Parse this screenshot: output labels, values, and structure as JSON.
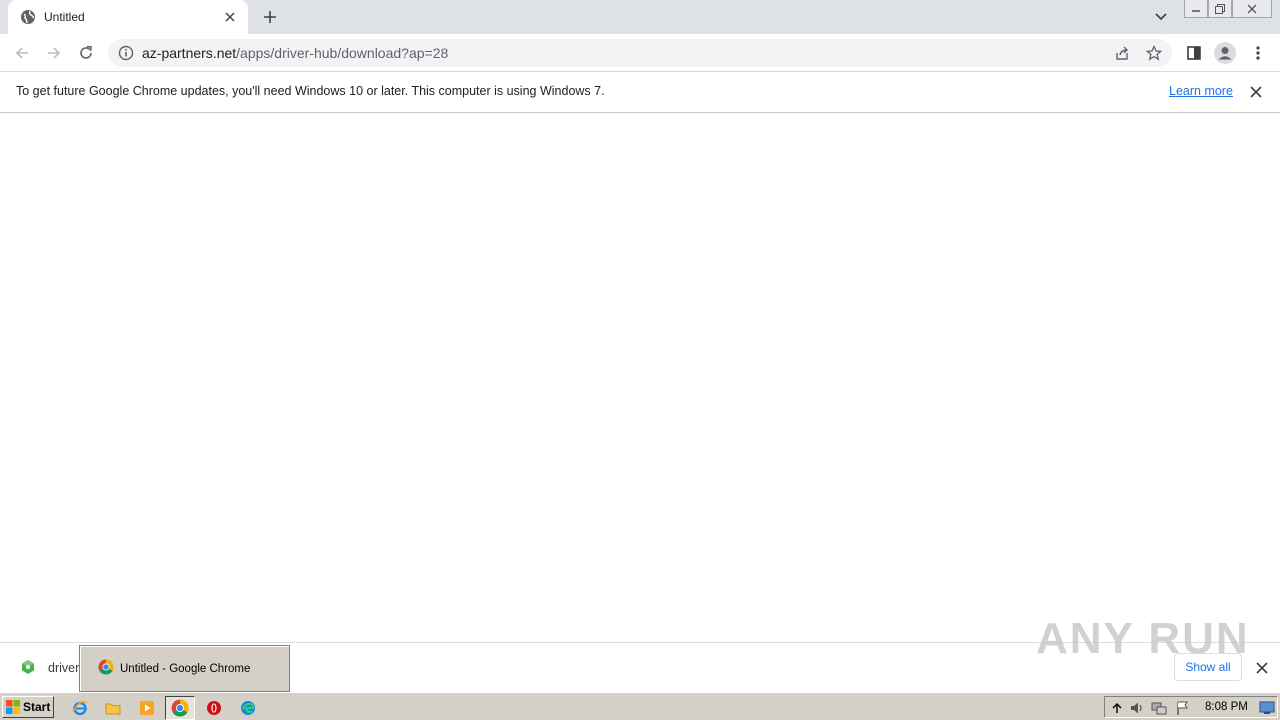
{
  "browser": {
    "tab": {
      "title": "Untitled"
    },
    "omnibox": {
      "url_host": "az-partners.net",
      "url_path": "/apps/driver-hub/download?ap=28"
    },
    "infobar": {
      "message": "To get future Google Chrome updates, you'll need Windows 10 or later. This computer is using Windows 7.",
      "learn_more": "Learn more"
    }
  },
  "download_shelf": {
    "item_name": "driver",
    "show_all": "Show all",
    "watermark": "ANY RUN"
  },
  "taskbar": {
    "start_label": "Start",
    "thumbnail_title": "Untitled - Google Chrome",
    "clock": "8:08 PM"
  },
  "colors": {
    "tabstrip": "#dee1e6",
    "omnibox": "#f1f3f4",
    "link": "#1a73e8",
    "taskbar": "#d4d0c8"
  }
}
